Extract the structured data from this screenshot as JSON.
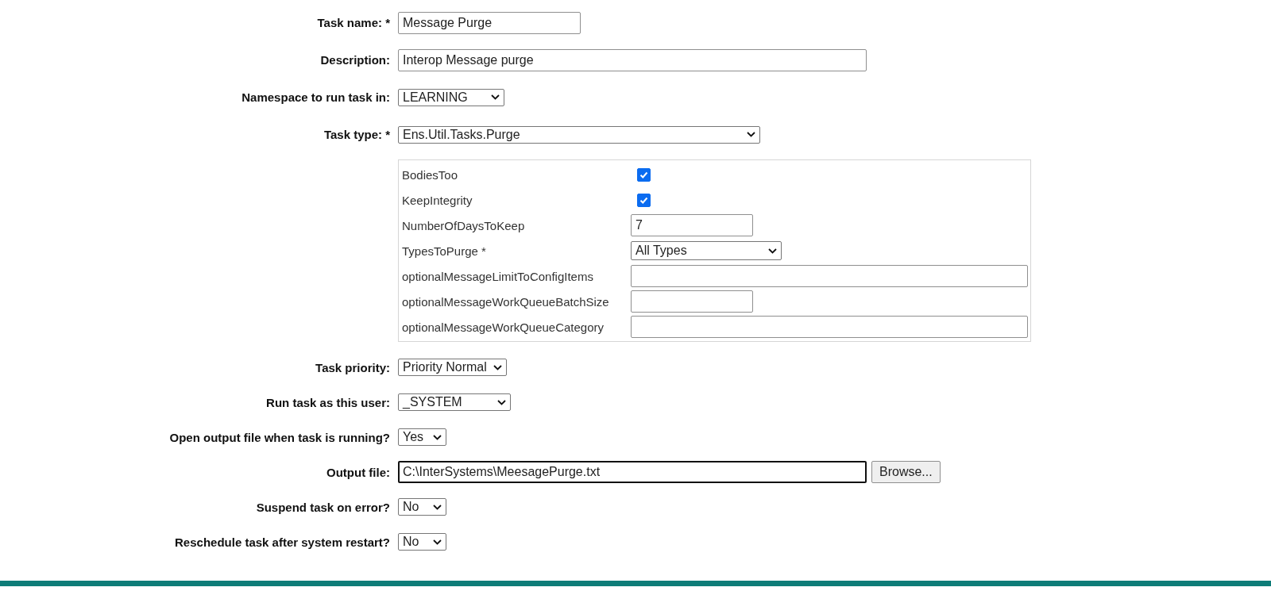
{
  "fields": [
    {
      "label": "Task name: *",
      "kind": "text",
      "value": "Message Purge",
      "focused": false
    },
    {
      "label": "Description:",
      "kind": "text",
      "value": "Interop Message purge",
      "focused": false
    },
    {
      "label": "Namespace to run task in:",
      "kind": "select",
      "value": "LEARNING",
      "focused": false
    },
    {
      "label": "Task type: *",
      "kind": "select",
      "value": "Ens.Util.Tasks.Purge",
      "focused": false
    }
  ],
  "task_settings": [
    {
      "label": "BodiesToo",
      "kind": "checkbox",
      "checked": true
    },
    {
      "label": "KeepIntegrity",
      "kind": "checkbox",
      "checked": true
    },
    {
      "label": "NumberOfDaysToKeep",
      "kind": "text",
      "value": "7"
    },
    {
      "label": "TypesToPurge *",
      "kind": "select",
      "value": "All Types"
    },
    {
      "label": "optionalMessageLimitToConfigItems",
      "kind": "text"
    },
    {
      "label": "optionalMessageWorkQueueBatchSize",
      "kind": "text"
    },
    {
      "label": "optionalMessageWorkQueueCategory",
      "kind": "text"
    }
  ],
  "options": [
    {
      "label": "Task priority:",
      "kind": "select",
      "value": "Priority Normal",
      "focused": false
    },
    {
      "label": "Run task as this user:",
      "kind": "select",
      "value": "_SYSTEM",
      "focused": false
    },
    {
      "label": "Open output file when task is running?",
      "kind": "select",
      "value": "Yes",
      "focused": false
    },
    {
      "label": "Output file:",
      "kind": "file",
      "value": "C:\\InterSystems\\MeesagePurge.txt",
      "button": "Browse...",
      "focused": true
    },
    {
      "label": "Suspend task on error?",
      "kind": "select",
      "value": "No",
      "focused": false
    },
    {
      "label": "Reschedule task after system restart?",
      "kind": "select",
      "value": "No",
      "focused": false
    }
  ]
}
